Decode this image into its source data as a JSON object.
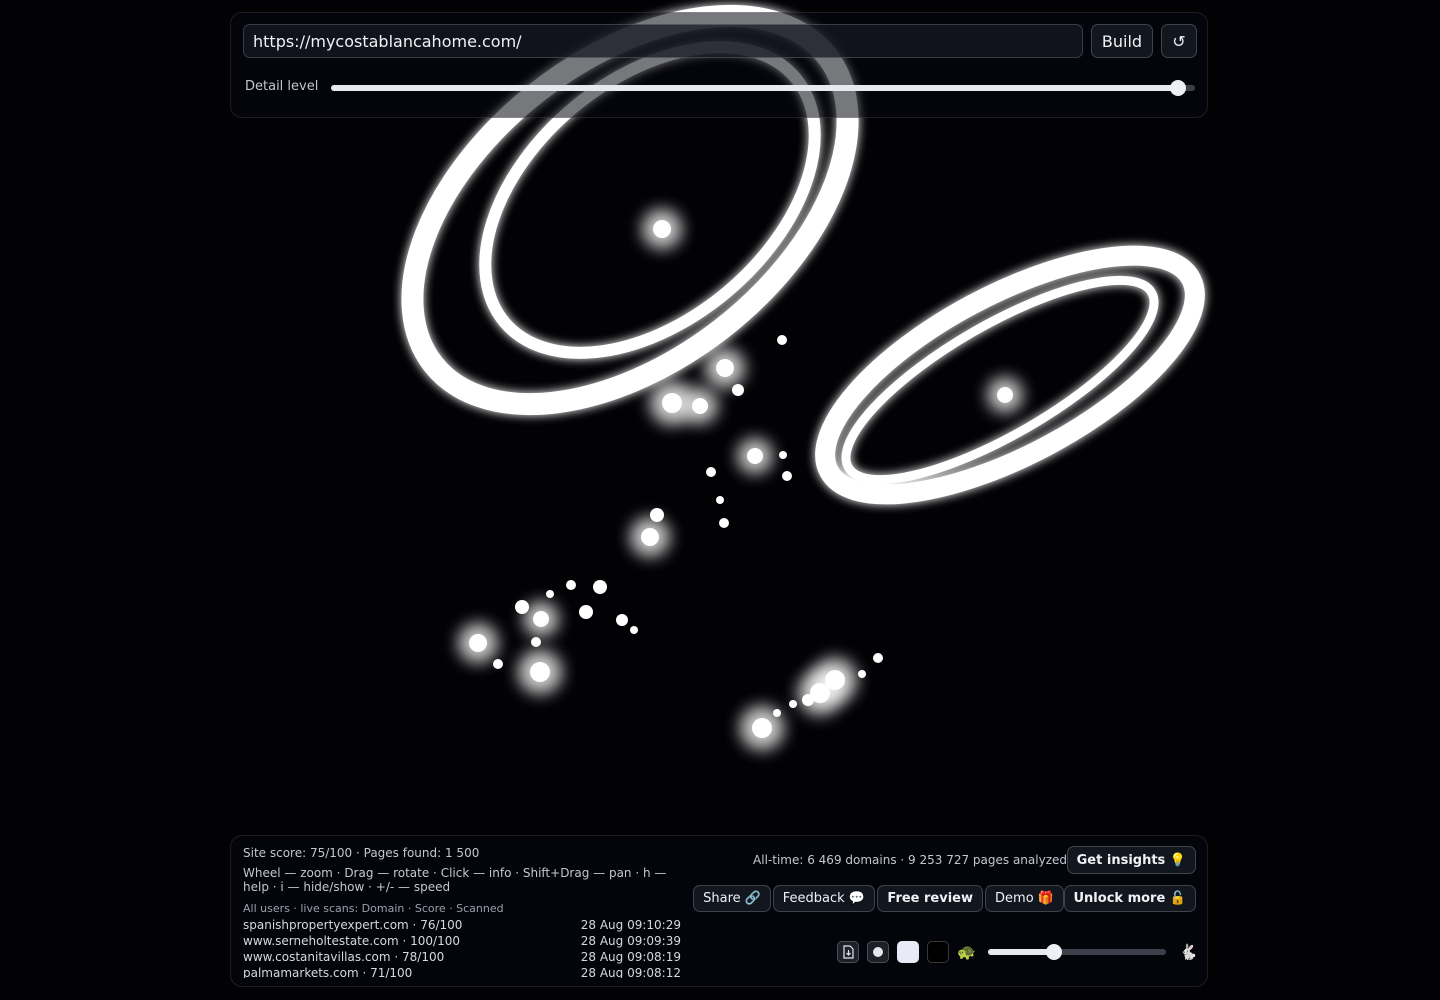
{
  "header": {
    "url_value": "https://mycostablancahome.com/",
    "build_label": "Build",
    "refresh_icon": "↺",
    "detail_label": "Detail level",
    "detail_level": 0.98
  },
  "stats": {
    "site_line": "Site score: 75/100 · Pages found: 1 500",
    "help_text": "Wheel — zoom · Drag — rotate · Click — info · Shift+Drag — pan · h — help · i — hide/show · +/- — speed",
    "scans_header": "All users · live scans: Domain · Score · Scanned",
    "alltime": "All-time: 6 469 domains · 9 253 727 pages analyzed"
  },
  "scans": [
    {
      "domain": "spanishpropertyexpert.com · 76/100",
      "time": "28 Aug 09:10:29"
    },
    {
      "domain": "www.serneholtestate.com · 100/100",
      "time": "28 Aug 09:09:39"
    },
    {
      "domain": "www.costanitavillas.com · 78/100",
      "time": "28 Aug 09:08:19"
    },
    {
      "domain": "palmamarkets.com · 71/100",
      "time": "28 Aug 09:08:12"
    }
  ],
  "buttons": {
    "insights": "Get insights 💡",
    "share": "Share 🔗",
    "feedback": "Feedback 💬",
    "review": "Free review",
    "demo": "Demo 🎁",
    "unlock": "Unlock more 🔓"
  },
  "speed": {
    "slow_icon": "🐢",
    "fast_icon": "🐇",
    "download_icon": "download-icon",
    "level": 0.37
  }
}
